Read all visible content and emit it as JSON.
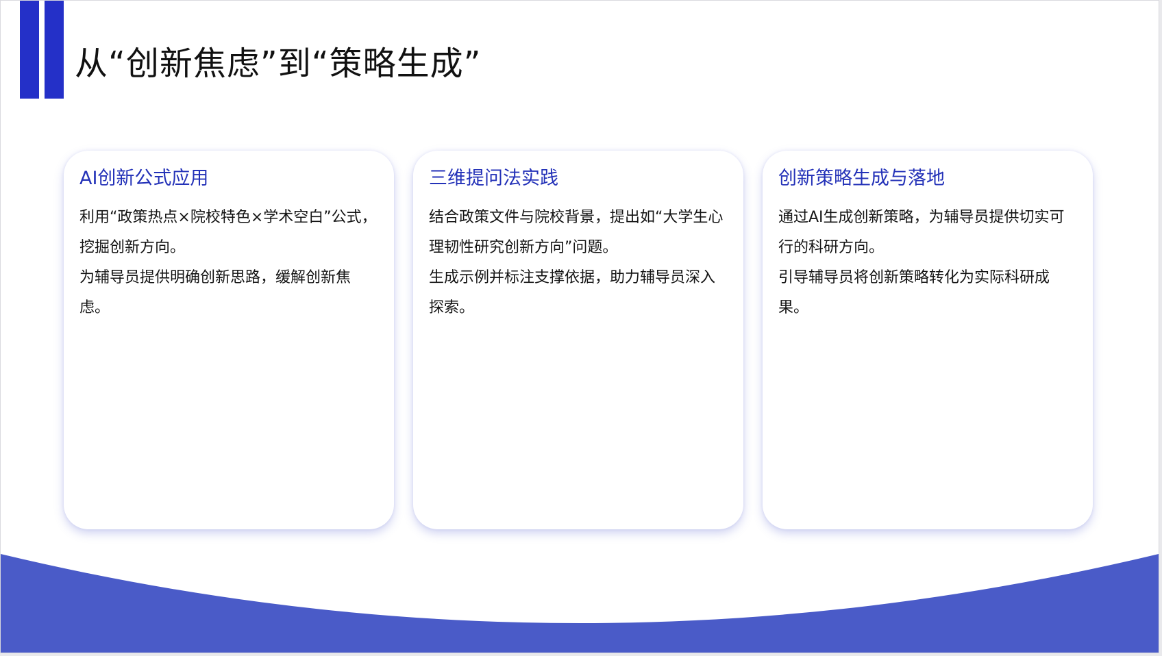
{
  "title": "从“创新焦虑”到“策略生成”",
  "accent_color": "#2430c8",
  "wave_color": "#4a5bc8",
  "cards": [
    {
      "heading": "AI创新公式应用",
      "paragraphs": [
        "利用“政策热点×院校特色×学术空白”公式，挖掘创新方向。",
        "为辅导员提供明确创新思路，缓解创新焦虑。"
      ]
    },
    {
      "heading": "三维提问法实践",
      "paragraphs": [
        "结合政策文件与院校背景，提出如“大学生心理韧性研究创新方向”问题。",
        "生成示例并标注支撑依据，助力辅导员深入探索。"
      ]
    },
    {
      "heading": "创新策略生成与落地",
      "paragraphs": [
        "通过AI生成创新策略，为辅导员提供切实可行的科研方向。",
        "引导辅导员将创新策略转化为实际科研成果。"
      ]
    }
  ]
}
